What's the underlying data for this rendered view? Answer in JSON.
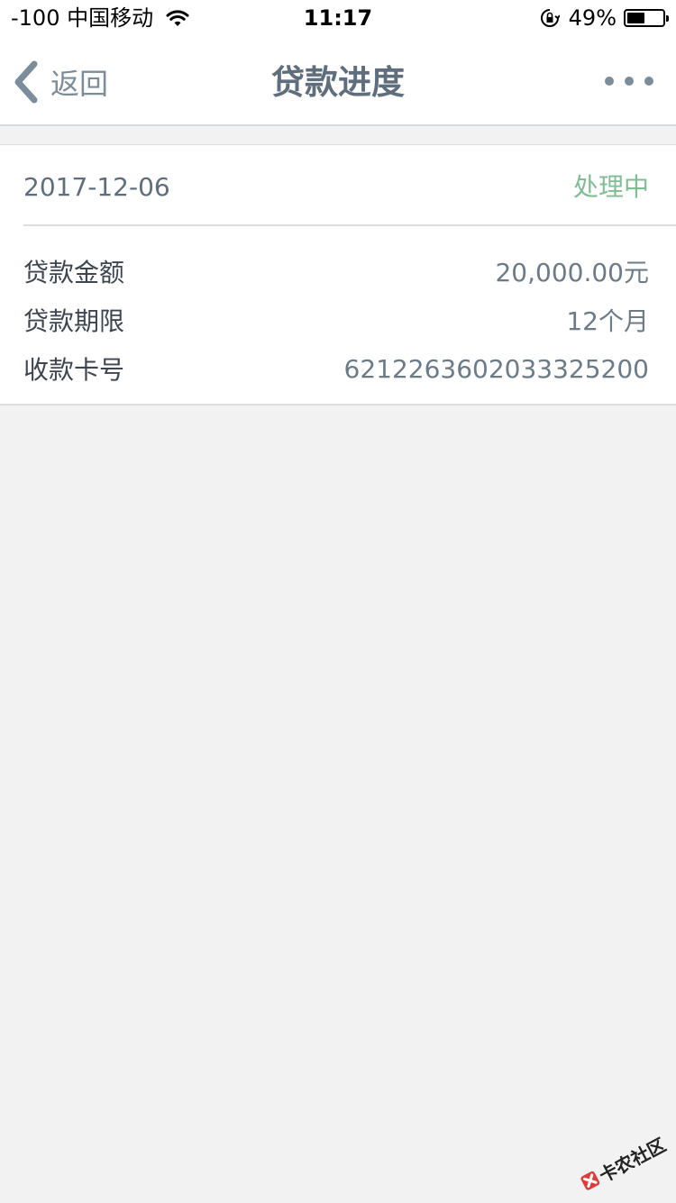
{
  "status_bar": {
    "carrier": "-100 中国移动",
    "time": "11:17",
    "battery_percent": "49%",
    "battery_level": 0.49
  },
  "nav": {
    "back_label": "返回",
    "title": "贷款进度"
  },
  "record": {
    "date": "2017-12-06",
    "status": "处理中",
    "rows": [
      {
        "label": "贷款金额",
        "value": "20,000.00元"
      },
      {
        "label": "贷款期限",
        "value": "12个月"
      },
      {
        "label": "收款卡号",
        "value": "6212263602033325200"
      }
    ]
  },
  "watermark": {
    "text": "卡农社区"
  },
  "colors": {
    "accent_status": "#7fbe94",
    "nav_text": "#5f6e7d",
    "background": "#f2f2f2"
  }
}
